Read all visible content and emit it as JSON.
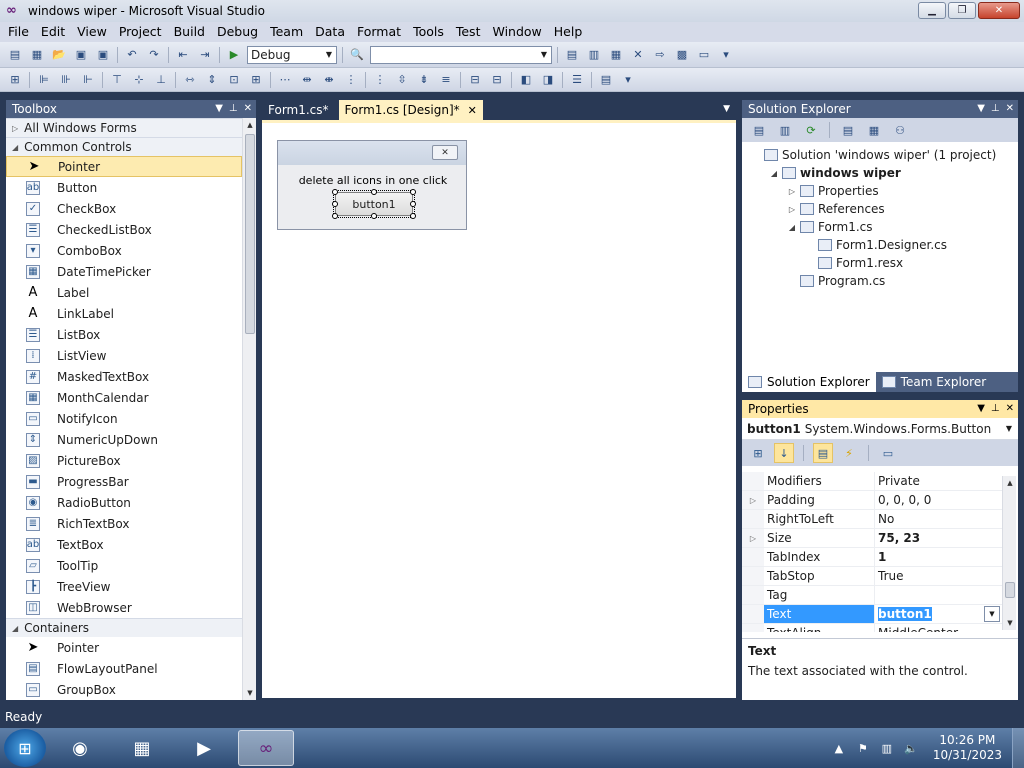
{
  "window": {
    "title": "windows wiper - Microsoft Visual Studio"
  },
  "menu": [
    "File",
    "Edit",
    "View",
    "Project",
    "Build",
    "Debug",
    "Team",
    "Data",
    "Format",
    "Tools",
    "Test",
    "Window",
    "Help"
  ],
  "toolbar": {
    "config": "Debug",
    "platform": ""
  },
  "toolbox": {
    "title": "Toolbox",
    "groups": [
      {
        "label": "All Windows Forms",
        "expanded": false,
        "items": []
      },
      {
        "label": "Common Controls",
        "expanded": true,
        "items": [
          {
            "label": "Pointer",
            "icon": "pointer-icon",
            "glyph": "➤"
          },
          {
            "label": "Button",
            "icon": "button-icon",
            "glyph": "ab"
          },
          {
            "label": "CheckBox",
            "icon": "checkbox-icon",
            "glyph": "✓"
          },
          {
            "label": "CheckedListBox",
            "icon": "checked-listbox-icon",
            "glyph": "☰"
          },
          {
            "label": "ComboBox",
            "icon": "combobox-icon",
            "glyph": "▾"
          },
          {
            "label": "DateTimePicker",
            "icon": "datetimepicker-icon",
            "glyph": "▦"
          },
          {
            "label": "Label",
            "icon": "label-icon",
            "glyph": "A"
          },
          {
            "label": "LinkLabel",
            "icon": "linklabel-icon",
            "glyph": "A"
          },
          {
            "label": "ListBox",
            "icon": "listbox-icon",
            "glyph": "☰"
          },
          {
            "label": "ListView",
            "icon": "listview-icon",
            "glyph": "⁞"
          },
          {
            "label": "MaskedTextBox",
            "icon": "maskedtextbox-icon",
            "glyph": "#"
          },
          {
            "label": "MonthCalendar",
            "icon": "monthcalendar-icon",
            "glyph": "▦"
          },
          {
            "label": "NotifyIcon",
            "icon": "notifyicon-icon",
            "glyph": "▭"
          },
          {
            "label": "NumericUpDown",
            "icon": "numericupdown-icon",
            "glyph": "⇕"
          },
          {
            "label": "PictureBox",
            "icon": "picturebox-icon",
            "glyph": "▨"
          },
          {
            "label": "ProgressBar",
            "icon": "progressbar-icon",
            "glyph": "▬"
          },
          {
            "label": "RadioButton",
            "icon": "radiobutton-icon",
            "glyph": "◉"
          },
          {
            "label": "RichTextBox",
            "icon": "richtextbox-icon",
            "glyph": "≣"
          },
          {
            "label": "TextBox",
            "icon": "textbox-icon",
            "glyph": "ab"
          },
          {
            "label": "ToolTip",
            "icon": "tooltip-icon",
            "glyph": "▱"
          },
          {
            "label": "TreeView",
            "icon": "treeview-icon",
            "glyph": "┣"
          },
          {
            "label": "WebBrowser",
            "icon": "webbrowser-icon",
            "glyph": "◫"
          }
        ]
      },
      {
        "label": "Containers",
        "expanded": true,
        "items": [
          {
            "label": "Pointer",
            "icon": "pointer-icon",
            "glyph": "➤"
          },
          {
            "label": "FlowLayoutPanel",
            "icon": "flowlayoutpanel-icon",
            "glyph": "▤"
          },
          {
            "label": "GroupBox",
            "icon": "groupbox-icon",
            "glyph": "▭"
          }
        ]
      }
    ]
  },
  "editor": {
    "tabs": [
      {
        "label": "Form1.cs*",
        "active": false
      },
      {
        "label": "Form1.cs [Design]*",
        "active": true
      }
    ],
    "form": {
      "label_text": "delete all icons in one click",
      "button_text": "button1"
    }
  },
  "solution_explorer": {
    "title": "Solution Explorer",
    "nodes": [
      {
        "label": "Solution 'windows wiper' (1 project)",
        "indent": 0,
        "tri": "",
        "bold": false
      },
      {
        "label": "windows wiper",
        "indent": 1,
        "tri": "◢",
        "bold": true
      },
      {
        "label": "Properties",
        "indent": 2,
        "tri": "▷",
        "bold": false
      },
      {
        "label": "References",
        "indent": 2,
        "tri": "▷",
        "bold": false
      },
      {
        "label": "Form1.cs",
        "indent": 2,
        "tri": "◢",
        "bold": false
      },
      {
        "label": "Form1.Designer.cs",
        "indent": 3,
        "tri": "",
        "bold": false
      },
      {
        "label": "Form1.resx",
        "indent": 3,
        "tri": "",
        "bold": false
      },
      {
        "label": "Program.cs",
        "indent": 2,
        "tri": "",
        "bold": false
      }
    ],
    "bottom_tabs": [
      "Solution Explorer",
      "Team Explorer"
    ]
  },
  "properties": {
    "title": "Properties",
    "object_name": "button1",
    "object_type": "System.Windows.Forms.Button",
    "rows": [
      {
        "name": "Modifiers",
        "value": "Private",
        "expand": false,
        "bold": false
      },
      {
        "name": "Padding",
        "value": "0, 0, 0, 0",
        "expand": true,
        "bold": false
      },
      {
        "name": "RightToLeft",
        "value": "No",
        "expand": false,
        "bold": false
      },
      {
        "name": "Size",
        "value": "75, 23",
        "expand": true,
        "bold": true
      },
      {
        "name": "TabIndex",
        "value": "1",
        "expand": false,
        "bold": true
      },
      {
        "name": "TabStop",
        "value": "True",
        "expand": false,
        "bold": false
      },
      {
        "name": "Tag",
        "value": "",
        "expand": false,
        "bold": false
      },
      {
        "name": "Text",
        "value": "button1",
        "expand": false,
        "bold": true,
        "selected": true
      },
      {
        "name": "TextAlign",
        "value": "MiddleCenter",
        "expand": false,
        "bold": false
      }
    ],
    "description_title": "Text",
    "description_text": "The text associated with the control."
  },
  "status": {
    "text": "Ready"
  },
  "taskbar": {
    "time": "10:26 PM",
    "date": "10/31/2023"
  }
}
